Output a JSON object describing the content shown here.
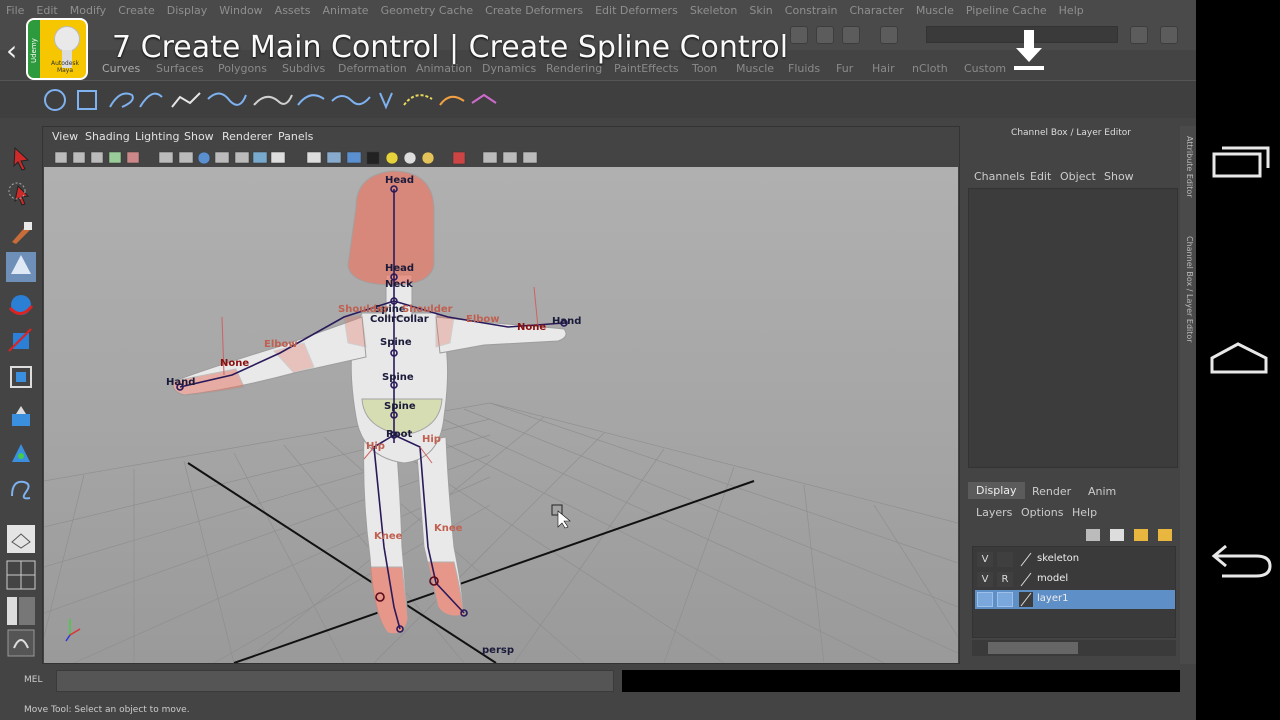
{
  "menubar": [
    "File",
    "Edit",
    "Modify",
    "Create",
    "Display",
    "Window",
    "Assets",
    "Animate",
    "Geometry Cache",
    "Create Deformers",
    "Edit Deformers",
    "Skeleton",
    "Skin",
    "Constrain",
    "Character",
    "Muscle",
    "Pipeline Cache",
    "Help"
  ],
  "shelf_tabs": [
    "Curves",
    "Surfaces",
    "Polygons",
    "Subdivs",
    "Deformation",
    "Animation",
    "Dynamics",
    "Rendering",
    "PaintEffects",
    "Toon",
    "Muscle",
    "Fluids",
    "Fur",
    "Hair",
    "nCloth",
    "Custom"
  ],
  "overlay": {
    "title": "7  Create Main Control | Create Spline Control",
    "logo_brand": "Udemy",
    "logo_caption": "Autodesk Maya",
    "back_glyph": "‹"
  },
  "viewport_menu": [
    "View",
    "Shading",
    "Lighting",
    "Show",
    "Renderer",
    "Panels"
  ],
  "camera_label": "persp",
  "joint_labels": {
    "head_top": "Head",
    "head": "Head",
    "neck": "Neck",
    "spine1": "Spine",
    "spine2": "Spine",
    "spine3": "Spine",
    "spine4": "Spine",
    "collar": "CollrCollar",
    "shoulder_l": "Shoulder",
    "shoulder_r": "Shoulder",
    "elbow_l": "Elbow",
    "elbow_r": "Elbow",
    "none_l": "None",
    "none_r": "None",
    "hand_l": "Hand",
    "hand_r": "Hand",
    "root": "Root",
    "hip_l": "Hip",
    "hip_r": "Hip",
    "knee_l": "Knee",
    "knee_r": "Knee"
  },
  "channel_box": {
    "title": "Channel Box / Layer Editor",
    "menu": [
      "Channels",
      "Edit",
      "Object",
      "Show"
    ]
  },
  "layer_editor": {
    "tabs": [
      "Display",
      "Render",
      "Anim"
    ],
    "menu": [
      "Layers",
      "Options",
      "Help"
    ],
    "layers": [
      {
        "v": "V",
        "r": "",
        "name": "skeleton",
        "selected": false
      },
      {
        "v": "V",
        "r": "R",
        "name": "model",
        "selected": false
      },
      {
        "v": "",
        "r": "",
        "name": "layer1",
        "selected": true
      }
    ]
  },
  "side_tabs": [
    "Attribute Editor",
    "Channel Box / Layer Editor"
  ],
  "command_line": {
    "label": "MEL",
    "value": ""
  },
  "help_line": "Move Tool: Select an object to move.",
  "colors": {
    "selected_layer": "#5e8fc7",
    "joint": "#2a1a5a",
    "skin_weight": "#e06a50"
  }
}
